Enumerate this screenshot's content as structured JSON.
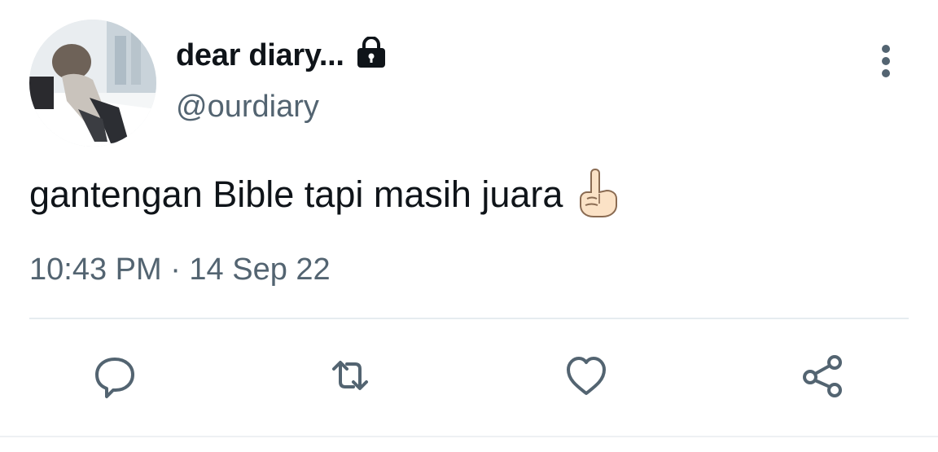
{
  "tweet": {
    "display_name": "dear diary...",
    "handle": "@ourdiary",
    "text": "gantengan Bible tapi masih juara",
    "emoji": "index-pointing-up-emoji",
    "timestamp": "10:43 PM · 14 Sep 22"
  },
  "icons": {
    "lock": "lock-icon",
    "more": "more-vertical-icon",
    "reply": "reply-icon",
    "retweet": "retweet-icon",
    "like": "heart-icon",
    "share": "share-icon"
  },
  "colors": {
    "text_primary": "#0f1419",
    "text_secondary": "#536471",
    "icon": "#536471",
    "divider": "#e6ecf0"
  }
}
